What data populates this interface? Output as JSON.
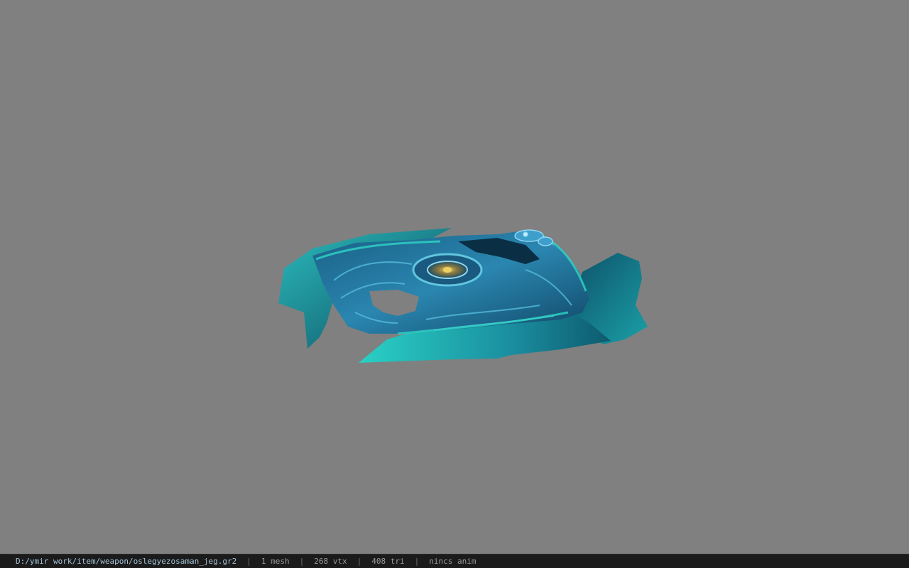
{
  "viewer": {
    "background_color": "#808080",
    "model_subject": "teal-blue ornate weapon mesh",
    "model_colors": {
      "dark": "#0c3a52",
      "mid": "#1f6f94",
      "light": "#3aa2c6",
      "rim": "#2fd0c0",
      "eye": "#e0c060"
    }
  },
  "status": {
    "path": "D:/ymir work/item/weapon/oslegyezosaman_jeg.gr2",
    "sep": "|",
    "mesh": "1 mesh",
    "vtx": "268 vtx",
    "tri": "408 tri",
    "anim": "nincs anim"
  }
}
